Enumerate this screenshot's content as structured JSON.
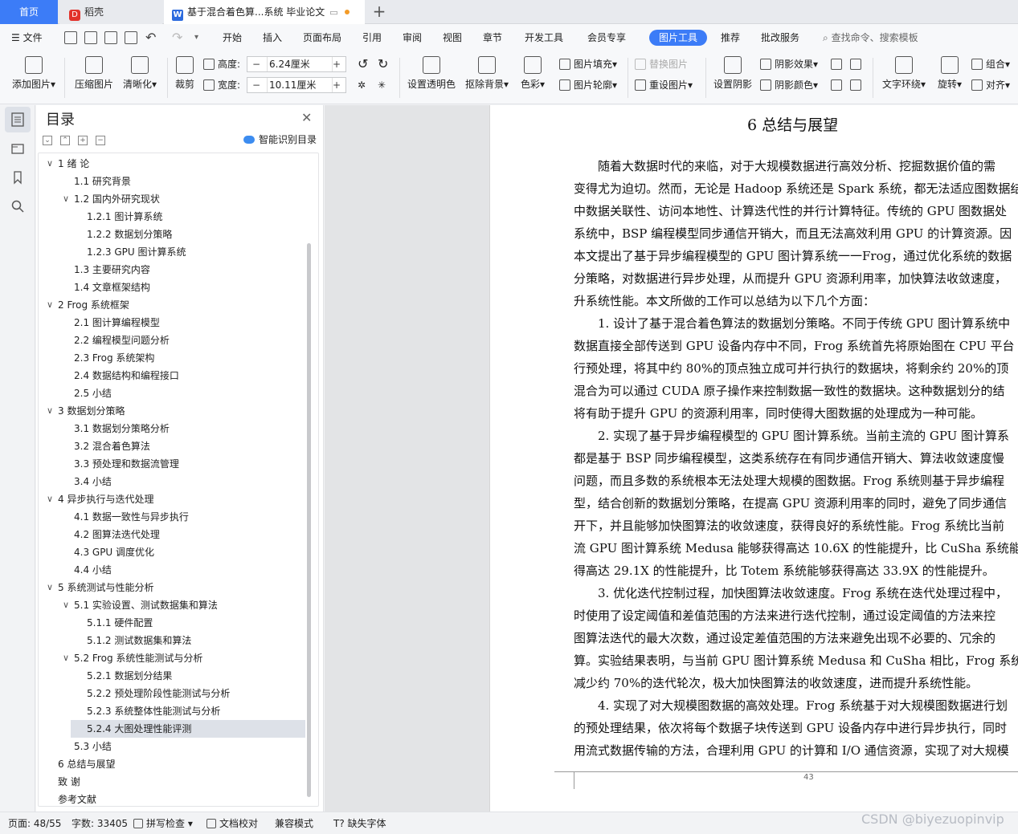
{
  "tabs": {
    "home": "首页",
    "docer": "稻壳",
    "document": "基于混合着色算...系统 毕业论文",
    "add": "+"
  },
  "menu": {
    "file": "文件",
    "items": [
      "开始",
      "插入",
      "页面布局",
      "引用",
      "审阅",
      "视图",
      "章节",
      "开发工具",
      "会员专享",
      "图片工具",
      "推荐",
      "批改服务"
    ],
    "search": "查找命令、搜索模板"
  },
  "ribbon": {
    "add_picture": "添加图片",
    "compress": "压缩图片",
    "sharpen": "清晰化",
    "crop": "裁剪",
    "height_label": "高度:",
    "height_value": "6.24厘米",
    "width_label": "宽度:",
    "width_value": "10.11厘米",
    "set_transparent": "设置透明色",
    "remove_bg": "抠除背景",
    "color": "色彩",
    "picture_fill": "图片填充",
    "picture_outline": "图片轮廓",
    "replace_picture": "替换图片",
    "reset_picture": "重设图片",
    "set_shadow": "设置阴影",
    "shadow_effect": "阴影效果",
    "shadow_color": "阴影颜色",
    "text_wrap": "文字环绕",
    "rotate": "旋转",
    "group": "组合",
    "align": "对齐"
  },
  "toc": {
    "title": "目录",
    "ai_label": "智能识别目录",
    "items": [
      {
        "text": "1    绪   论",
        "level": 0,
        "arrow": "v"
      },
      {
        "text": "1.1  研究背景",
        "level": 1,
        "arrow": ""
      },
      {
        "text": "1.2  国内外研究现状",
        "level": 1,
        "arrow": "v"
      },
      {
        "text": "1.2.1  图计算系统",
        "level": 2,
        "arrow": ""
      },
      {
        "text": "1.2.2  数据划分策略",
        "level": 2,
        "arrow": ""
      },
      {
        "text": "1.2.3 GPU 图计算系统",
        "level": 2,
        "arrow": ""
      },
      {
        "text": "1.3  主要研究内容",
        "level": 1,
        "arrow": ""
      },
      {
        "text": "1.4  文章框架结构",
        "level": 1,
        "arrow": ""
      },
      {
        "text": "2     Frog 系统框架",
        "level": 0,
        "arrow": "v"
      },
      {
        "text": "2.1  图计算编程模型",
        "level": 1,
        "arrow": ""
      },
      {
        "text": "2.2  编程模型问题分析",
        "level": 1,
        "arrow": ""
      },
      {
        "text": "2.3 Frog 系统架构",
        "level": 1,
        "arrow": ""
      },
      {
        "text": "2.4  数据结构和编程接口",
        "level": 1,
        "arrow": ""
      },
      {
        "text": "2.5  小结",
        "level": 1,
        "arrow": ""
      },
      {
        "text": "3     数据划分策略",
        "level": 0,
        "arrow": "v"
      },
      {
        "text": "3.1  数据划分策略分析",
        "level": 1,
        "arrow": ""
      },
      {
        "text": "3.2  混合着色算法",
        "level": 1,
        "arrow": ""
      },
      {
        "text": "3.3  预处理和数据流管理",
        "level": 1,
        "arrow": ""
      },
      {
        "text": "3.4  小结",
        "level": 1,
        "arrow": ""
      },
      {
        "text": "4     异步执行与迭代处理",
        "level": 0,
        "arrow": "v"
      },
      {
        "text": "4.1  数据一致性与异步执行",
        "level": 1,
        "arrow": ""
      },
      {
        "text": "4.2  图算法迭代处理",
        "level": 1,
        "arrow": ""
      },
      {
        "text": "4.3 GPU 调度优化",
        "level": 1,
        "arrow": ""
      },
      {
        "text": "4.4  小结",
        "level": 1,
        "arrow": ""
      },
      {
        "text": "5     系统测试与性能分析",
        "level": 0,
        "arrow": "v"
      },
      {
        "text": "5.1  实验设置、测试数据集和算法",
        "level": 1,
        "arrow": "v"
      },
      {
        "text": "5.1.1 硬件配置",
        "level": 2,
        "arrow": ""
      },
      {
        "text": "5.1.2 测试数据集和算法",
        "level": 2,
        "arrow": ""
      },
      {
        "text": "5.2 Frog 系统性能测试与分析",
        "level": 1,
        "arrow": "v"
      },
      {
        "text": "5.2.1  数据划分结果",
        "level": 2,
        "arrow": ""
      },
      {
        "text": "5.2.2  预处理阶段性能测试与分析",
        "level": 2,
        "arrow": ""
      },
      {
        "text": "5.2.3  系统整体性能测试与分析",
        "level": 2,
        "arrow": ""
      },
      {
        "text": "5.2.4  大图处理性能评测",
        "level": 2,
        "arrow": "",
        "selected": true
      },
      {
        "text": "5.3  小结",
        "level": 1,
        "arrow": ""
      },
      {
        "text": "6     总结与展望",
        "level": 0,
        "arrow": ""
      },
      {
        "text": "致   谢",
        "level": 0,
        "arrow": ""
      },
      {
        "text": "参考文献",
        "level": 0,
        "arrow": ""
      }
    ]
  },
  "page": {
    "title": "6     总结与展望",
    "lines": [
      "随着大数据时代的来临，对于大规模数据进行高效分析、挖掘数据价值的需",
      "变得尤为迫切。然而，无论是 Hadoop 系统还是 Spark 系统，都无法适应图数据结",
      "中数据关联性、访问本地性、计算迭代性的并行计算特征。传统的 GPU 图数据处",
      "系统中，BSP 编程模型同步通信开销大，而且无法高效利用 GPU 的计算资源。因",
      "本文提出了基于异步编程模型的 GPU 图计算系统一一Frog，通过优化系统的数据",
      "分策略，对数据进行异步处理，从而提升 GPU 资源利用率，加快算法收敛速度，",
      "升系统性能。本文所做的工作可以总结为以下几个方面：",
      "1. 设计了基于混合着色算法的数据划分策略。不同于传统 GPU 图计算系统中",
      "数据直接全部传送到 GPU 设备内存中不同，Frog 系统首先将原始图在 CPU 平台",
      "行预处理，将其中约 80%的顶点独立成可并行执行的数据块，将剩余约 20%的顶",
      "混合为可以通过 CUDA 原子操作来控制数据一致性的数据块。这种数据划分的结",
      "将有助于提升 GPU 的资源利用率，同时使得大图数据的处理成为一种可能。",
      "2. 实现了基于异步编程模型的 GPU 图计算系统。当前主流的 GPU 图计算系",
      "都是基于 BSP 同步编程模型，这类系统存在有同步通信开销大、算法收敛速度慢",
      "问题，而且多数的系统根本无法处理大规模的图数据。Frog 系统则基于异步编程",
      "型，结合创新的数据划分策略，在提高 GPU 资源利用率的同时，避免了同步通信",
      "开下，并且能够加快图算法的收敛速度，获得良好的系统性能。Frog 系统比当前",
      "流 GPU 图计算系统 Medusa 能够获得高达 10.6X 的性能提升，比 CuSha 系统能够",
      "得高达 29.1X 的性能提升，比 Totem 系统能够获得高达 33.9X 的性能提升。",
      "3. 优化迭代控制过程，加快图算法收敛速度。Frog 系统在迭代处理过程中，",
      "时使用了设定阈值和差值范围的方法来进行迭代控制，通过设定阈值的方法来控",
      "图算法迭代的最大次数，通过设定差值范围的方法来避免出现不必要的、冗余的",
      "算。实验结果表明，与当前 GPU 图计算系统 Medusa 和 CuSha 相比，Frog 系统可",
      "减少约 70%的迭代轮次，极大加快图算法的收敛速度，进而提升系统性能。",
      "4. 实现了对大规模图数据的高效处理。Frog 系统基于对大规模图数据进行划",
      "的预处理结果，依次将每个数据子块传送到 GPU 设备内存中进行异步执行，同时",
      "用流式数据传输的方法，合理利用 GPU 的计算和 I/O 通信资源，实现了对大规模"
    ],
    "page_number": "43"
  },
  "status": {
    "page": "页面: 48/55",
    "words": "字数: 33405",
    "spell": "拼写检查",
    "proof": "文档校对",
    "compat": "兼容模式",
    "missing_font": "缺失字体"
  },
  "watermark": "CSDN @biyezuopinvip",
  "colors": {
    "accent": "#3c7cf7",
    "selected_row": "#dde1e8"
  }
}
